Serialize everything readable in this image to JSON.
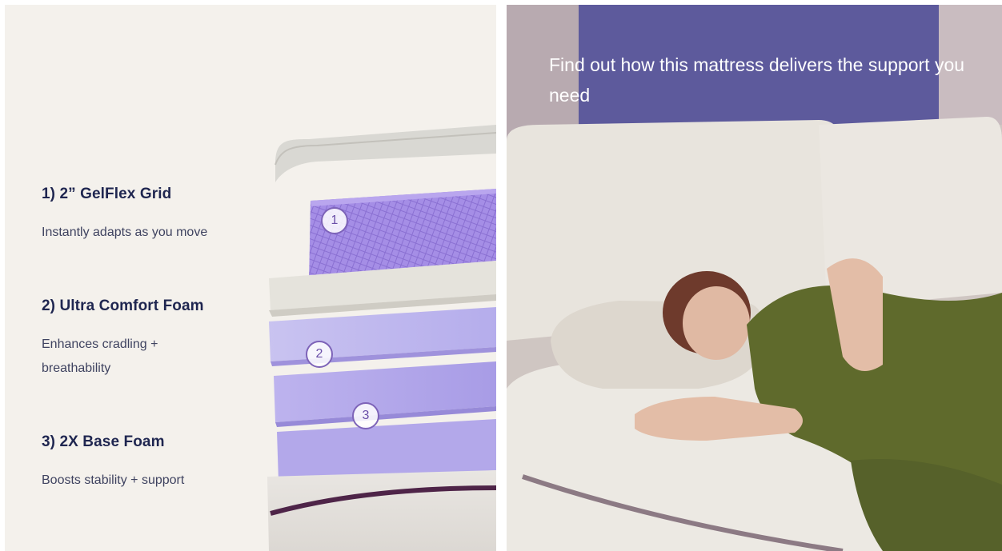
{
  "layers": [
    {
      "number": "1",
      "title": "1) 2” GelFlex Grid",
      "description": "Instantly adapts as you move"
    },
    {
      "number": "2",
      "title": "2) Ultra Comfort Foam",
      "description": "Enhances cradling + breathability"
    },
    {
      "number": "3",
      "title": "3) 2X Base Foam",
      "description": "Boosts stability + support"
    }
  ],
  "video": {
    "caption": "Find out how this mattress delivers the support you need"
  },
  "colors": {
    "heading": "#1f2650",
    "accent_purple": "#9b86dd",
    "panel_bg": "#f4f1ec"
  }
}
